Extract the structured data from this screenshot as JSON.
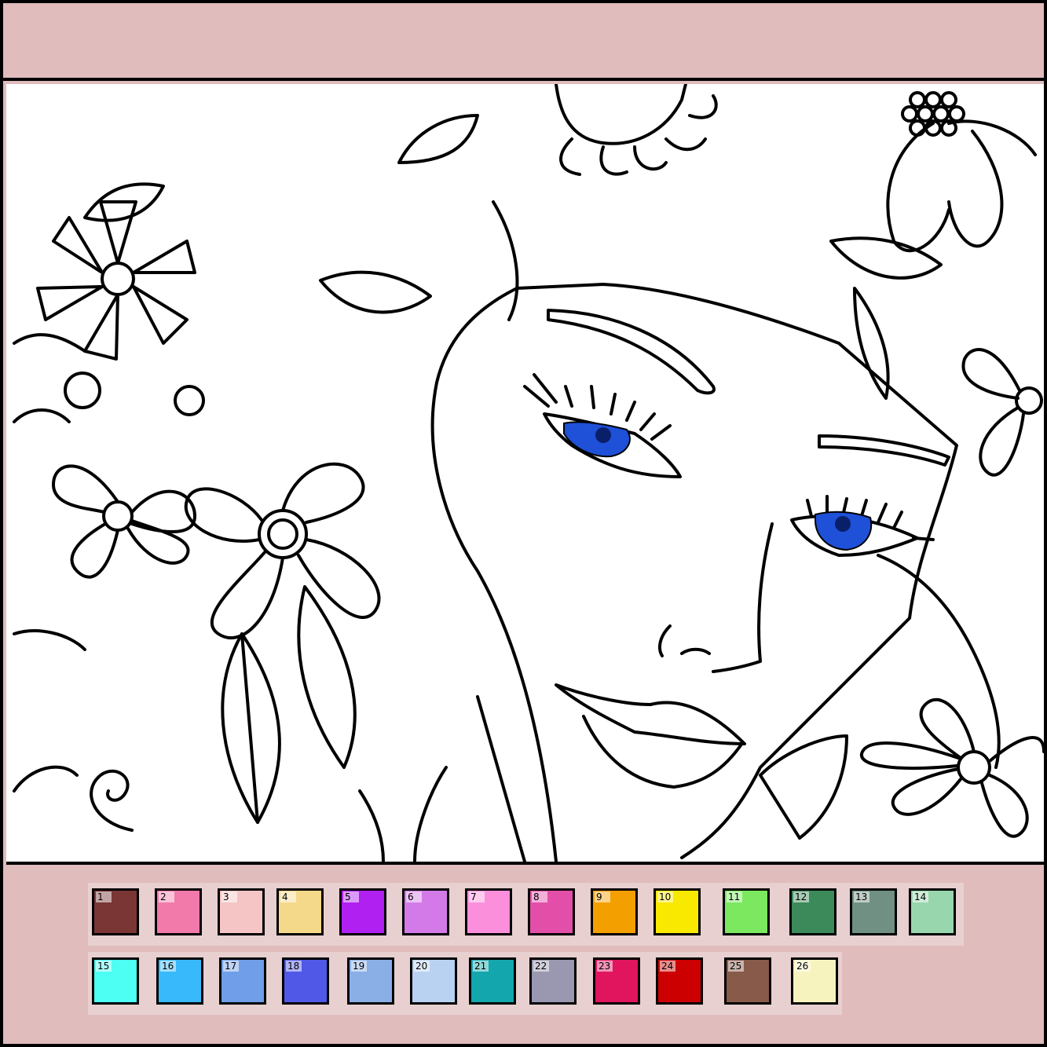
{
  "palette": [
    {
      "num": "1",
      "color": "#7a3535"
    },
    {
      "num": "2",
      "color": "#f27aab"
    },
    {
      "num": "3",
      "color": "#f5c4c4"
    },
    {
      "num": "4",
      "color": "#f5d98a"
    },
    {
      "num": "5",
      "color": "#b020f0"
    },
    {
      "num": "6",
      "color": "#d47ae8"
    },
    {
      "num": "7",
      "color": "#fb8fdc"
    },
    {
      "num": "8",
      "color": "#e34fa8"
    },
    {
      "num": "9",
      "color": "#f49f00"
    },
    {
      "num": "10",
      "color": "#f9e800"
    },
    {
      "num": "11",
      "color": "#7be85f"
    },
    {
      "num": "12",
      "color": "#3c8a5a"
    },
    {
      "num": "13",
      "color": "#6f9083"
    },
    {
      "num": "14",
      "color": "#98d6ae"
    },
    {
      "num": "15",
      "color": "#4dfef3"
    },
    {
      "num": "16",
      "color": "#38b9fb"
    },
    {
      "num": "17",
      "color": "#709ee8"
    },
    {
      "num": "18",
      "color": "#5058e8"
    },
    {
      "num": "19",
      "color": "#8aaee6"
    },
    {
      "num": "20",
      "color": "#bad2f2"
    },
    {
      "num": "21",
      "color": "#13a6ac"
    },
    {
      "num": "22",
      "color": "#9a97b0"
    },
    {
      "num": "23",
      "color": "#e0155e"
    },
    {
      "num": "24",
      "color": "#cc0000"
    },
    {
      "num": "25",
      "color": "#875a4a"
    },
    {
      "num": "26",
      "color": "#f7f3bf"
    }
  ],
  "colors": {
    "frame": "#e0bcbc",
    "eye": "#1e50d8"
  }
}
